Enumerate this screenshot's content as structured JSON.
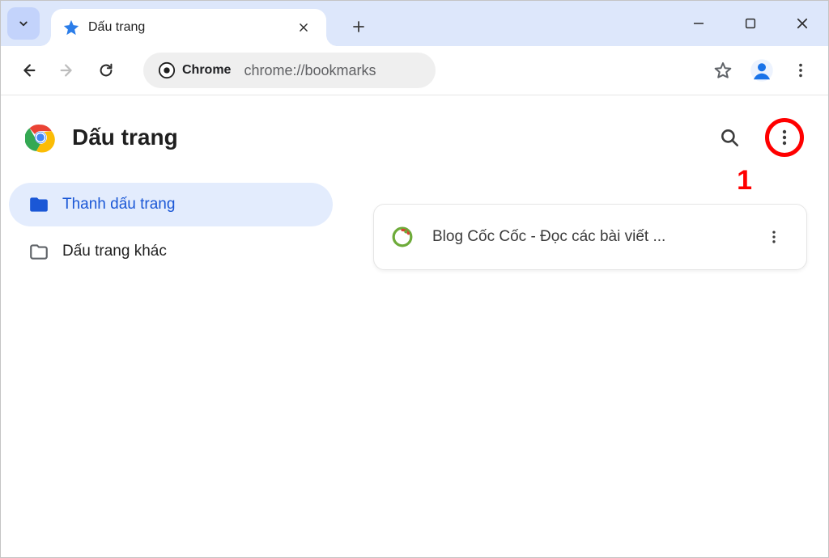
{
  "tab": {
    "title": "Dấu trang"
  },
  "omnibox": {
    "chip": "Chrome",
    "url": "chrome://bookmarks"
  },
  "bookmarks": {
    "title": "Dấu trang",
    "folders": [
      {
        "label": "Thanh dấu trang",
        "active": true
      },
      {
        "label": "Dấu trang khác",
        "active": false
      }
    ],
    "items": [
      {
        "title": "Blog Cốc Cốc - Đọc các bài viết ..."
      }
    ]
  },
  "annotation": {
    "text": "1"
  }
}
